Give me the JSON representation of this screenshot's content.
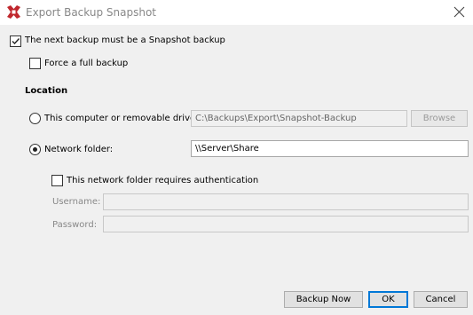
{
  "window": {
    "title": "Export Backup Snapshot"
  },
  "snapshot": {
    "label": "The next backup must be a Snapshot backup",
    "checked": true
  },
  "full_backup": {
    "label": "Force a full backup",
    "checked": false
  },
  "location": {
    "heading": "Location",
    "computer_option": {
      "label": "This computer or removable drive:",
      "value": "C:\\Backups\\Export\\Snapshot-Backup",
      "browse_label": "Browse"
    },
    "network_option": {
      "label": "Network folder:",
      "value": "\\\\Server\\Share",
      "selected": true
    },
    "auth": {
      "label": "This network folder requires authentication",
      "checked": false,
      "username_label": "Username:",
      "password_label": "Password:",
      "username_value": "",
      "password_value": ""
    }
  },
  "footer": {
    "backup_now_label": "Backup Now",
    "ok_label": "OK",
    "cancel_label": "Cancel"
  },
  "icons": {
    "app": "app-logo-icon",
    "close": "close-icon",
    "check": "checkmark-icon"
  },
  "colors": {
    "accent": "#0078d7",
    "brand_red": "#c0272d"
  }
}
